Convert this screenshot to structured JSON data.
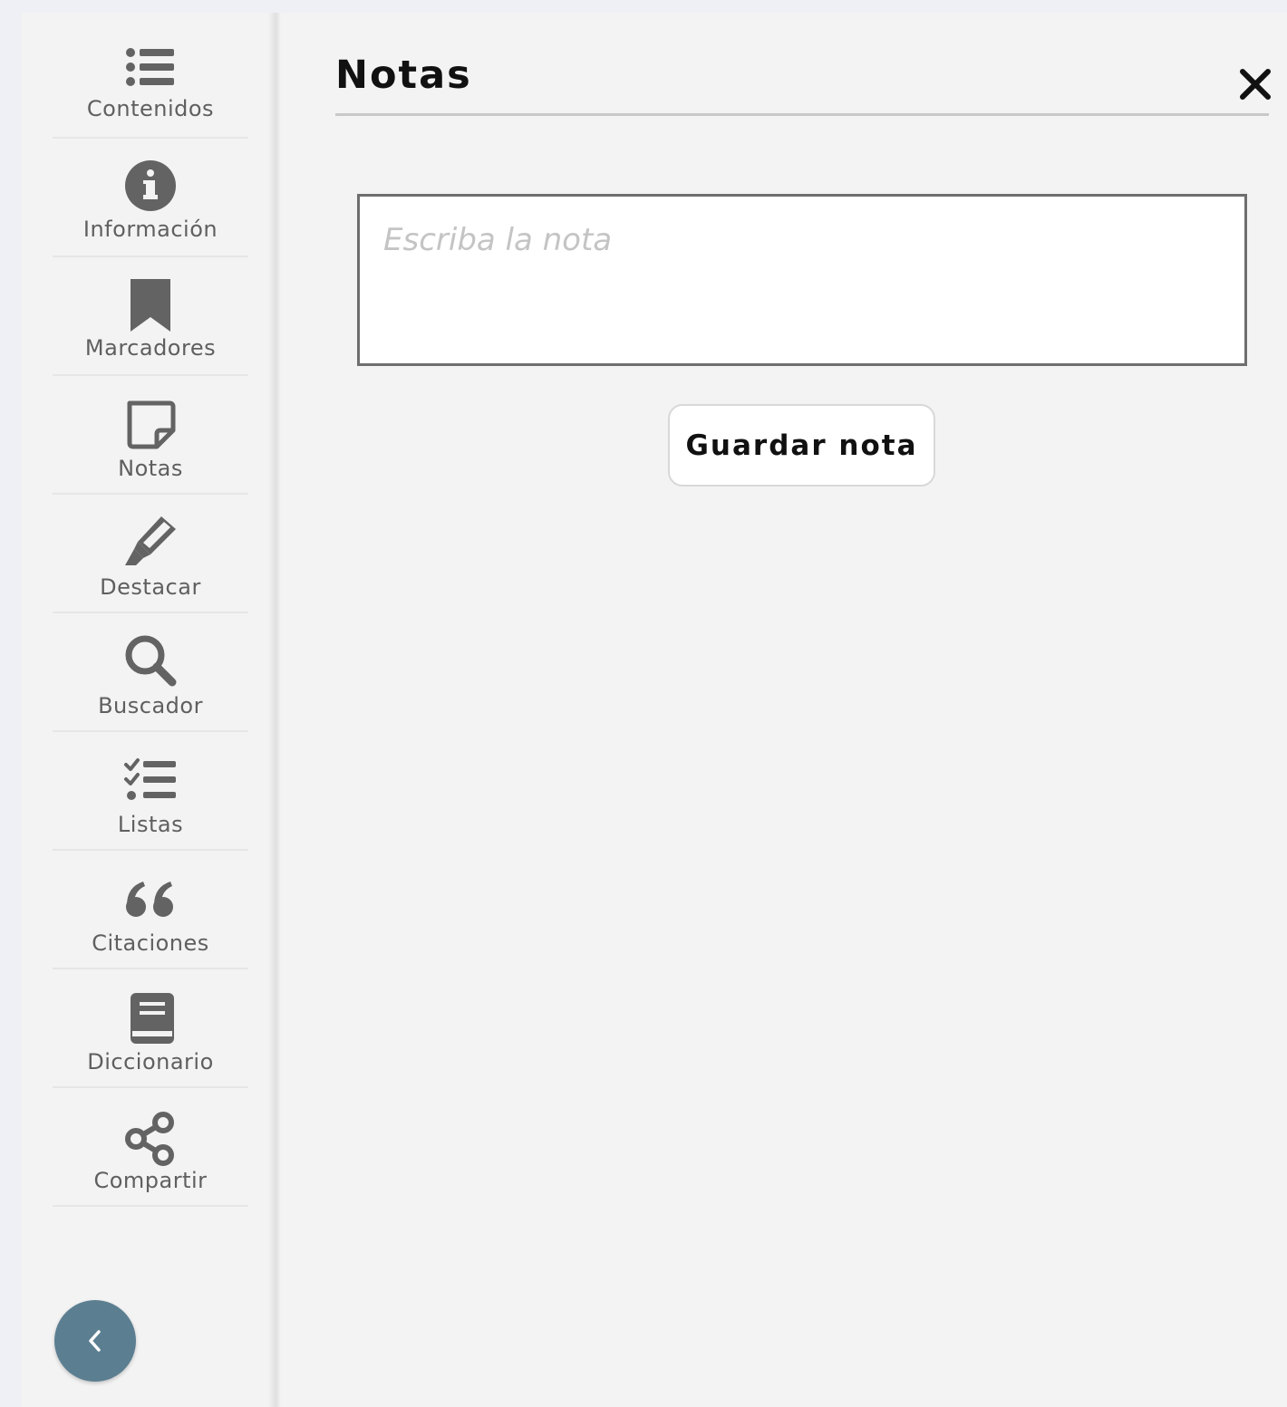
{
  "sidebar": {
    "items": [
      {
        "label": "Contenidos",
        "icon": "list-icon"
      },
      {
        "label": "Información",
        "icon": "info-icon"
      },
      {
        "label": "Marcadores",
        "icon": "bookmark-icon"
      },
      {
        "label": "Notas",
        "icon": "note-icon"
      },
      {
        "label": "Destacar",
        "icon": "highlighter-icon"
      },
      {
        "label": "Buscador",
        "icon": "search-icon"
      },
      {
        "label": "Listas",
        "icon": "checklist-icon"
      },
      {
        "label": "Citaciones",
        "icon": "quote-icon"
      },
      {
        "label": "Diccionario",
        "icon": "book-icon"
      },
      {
        "label": "Compartir",
        "icon": "share-icon"
      }
    ],
    "collapse_icon": "chevron-left-icon"
  },
  "panel": {
    "title": "Notas",
    "close_icon": "close-icon",
    "note_placeholder": "Escriba la nota",
    "note_value": "",
    "save_label": "Guardar nota"
  },
  "colors": {
    "icon": "#636363",
    "label": "#5f5f5f",
    "collapse_button": "#5b7f91",
    "panel_background": "#f3f3f3"
  }
}
